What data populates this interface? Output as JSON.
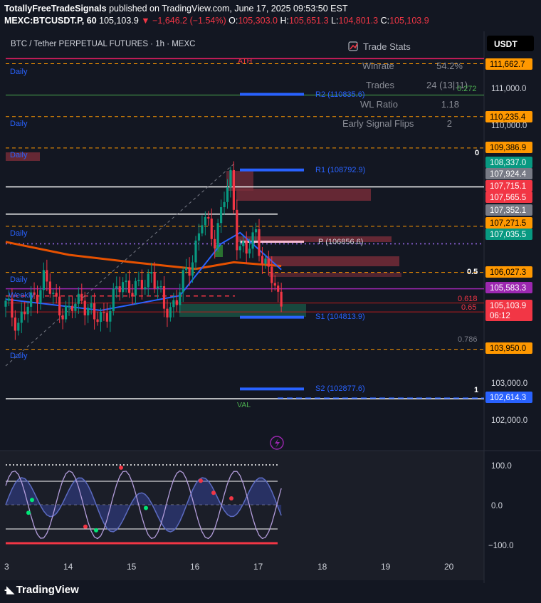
{
  "header": {
    "author": "TotallyFreeTradeSignals",
    "published_text": "published on TradingView.com, June 17, 2025 09:53:50 EST",
    "symbol": "MEXC:BTCUSDT.P, 60",
    "last": "105,103.9",
    "change": "▼ −1,646.2 (−1.54%)",
    "o_label": "O:",
    "o": "105,303.0",
    "h_label": "H:",
    "h": "105,651.3",
    "l_label": "L:",
    "l": "104,801.3",
    "c_label": "C:",
    "c": "105,103.9"
  },
  "legend_title": "BTC / Tether PERPETUAL FUTURES · 1h · MEXC",
  "currency_button": "USDT",
  "trade_stats": {
    "title": "Trade Stats",
    "rows": [
      {
        "label": "Winrate",
        "value": "54.2%"
      },
      {
        "label": "Trades",
        "value": "24 (13|11)"
      },
      {
        "label": "WL Ratio",
        "value": "1.18"
      },
      {
        "label": "Early Signal Flips",
        "value": "2"
      }
    ]
  },
  "level_labels": {
    "ath": "ATH",
    "val": "VAL",
    "r2": "R2 (110835.6)",
    "r1": "R1 (108792.9)",
    "p": "P (106856.6)",
    "s1": "S1 (104813.9)",
    "s2": "S2 (102877.6)",
    "daily": "Daily",
    "weekly": "Weekly",
    "fib_0": "0",
    "fib_05": "0.5",
    "fib_0618": "0.618",
    "fib_065": "0.65",
    "fib_0786": "0.786",
    "fib_1": "1",
    "fib_0272": "0.272"
  },
  "price_axis": {
    "ticks": [
      "111,000.0",
      "110,000.0",
      "103,000.0",
      "102,000.0"
    ],
    "tags": [
      {
        "text": "111,662.7",
        "color": "#ff9800"
      },
      {
        "text": "110,235.4",
        "color": "#ff9800"
      },
      {
        "text": "109,386.9",
        "color": "#ff9800"
      },
      {
        "text": "108,337.0",
        "color": "#089981"
      },
      {
        "text": "107,924.4",
        "color": "#787b86"
      },
      {
        "text": "107,715.1",
        "color": "#f23645"
      },
      {
        "text": "107,565.5",
        "color": "#f23645"
      },
      {
        "text": "107,352.1",
        "color": "#787b86"
      },
      {
        "text": "107,271.5",
        "color": "#ff9800"
      },
      {
        "text": "107,035.5",
        "color": "#089981"
      },
      {
        "text": "106,027.3",
        "color": "#ff9800"
      },
      {
        "text": "105,583.3",
        "color": "#9c27b0"
      },
      {
        "text": "105,103.9",
        "color": "#f23645"
      },
      {
        "text": "06:12",
        "color": "#f23645"
      },
      {
        "text": "103,950.0",
        "color": "#ff9800"
      },
      {
        "text": "102,614.3",
        "color": "#2962ff"
      }
    ]
  },
  "oscillator_axis": {
    "ticks": [
      "100.0",
      "0.0",
      "−100.0"
    ]
  },
  "time_axis": {
    "labels": [
      "3",
      "14",
      "15",
      "16",
      "17",
      "18",
      "19",
      "20"
    ]
  },
  "footer": {
    "brand": "TradingView"
  },
  "colors": {
    "background": "#131722",
    "up": "#089981",
    "down": "#f23645",
    "orange": "#ff9800",
    "blue": "#2962ff",
    "purple": "#9c27b0"
  },
  "chart_data": {
    "type": "candlestick",
    "title": "BTC / Tether PERPETUAL FUTURES · 1h · MEXC",
    "x_labels": [
      "3",
      "14",
      "15",
      "16",
      "17",
      "18",
      "19",
      "20"
    ],
    "ylim": [
      101700,
      112300
    ],
    "close_path": [
      [
        0,
        105100
      ],
      [
        4,
        104700
      ],
      [
        8,
        105200
      ],
      [
        12,
        105900
      ],
      [
        15,
        105300
      ],
      [
        20,
        104900
      ],
      [
        24,
        105400
      ],
      [
        28,
        104700
      ],
      [
        33,
        105100
      ],
      [
        37,
        105800
      ],
      [
        42,
        105500
      ],
      [
        46,
        106100
      ],
      [
        50,
        105000
      ],
      [
        54,
        105300
      ],
      [
        58,
        106200
      ],
      [
        62,
        107400
      ],
      [
        66,
        107000
      ],
      [
        69,
        108000
      ],
      [
        71,
        108500
      ],
      [
        73,
        107000
      ],
      [
        76,
        106500
      ],
      [
        79,
        107100
      ],
      [
        82,
        106200
      ],
      [
        85,
        105600
      ],
      [
        87,
        105104
      ]
    ],
    "moving_averages": [
      {
        "name": "",
        "color": "#e65100",
        "values": [
          [
            0,
            106850
          ],
          [
            20,
            106500
          ],
          [
            40,
            106300
          ],
          [
            60,
            106120
          ],
          [
            72,
            106300
          ],
          [
            87,
            106200
          ]
        ]
      },
      {
        "name": "",
        "color": "#2962ff",
        "values": [
          [
            0,
            105300
          ],
          [
            30,
            105000
          ],
          [
            55,
            105400
          ],
          [
            68,
            106800
          ],
          [
            74,
            107100
          ],
          [
            87,
            106100
          ]
        ]
      }
    ],
    "levels": {
      "ATH": 111800,
      "R2": 110835.6,
      "R1": 108792.9,
      "P": 106856.6,
      "S1": 104813.9,
      "S2": 102877.6,
      "daily": [
        111662.7,
        110235.4,
        109386.9,
        107271.5,
        106027.3,
        103950.0
      ],
      "weekly": 105583.3
    },
    "oscillator": {
      "ylim": [
        -100,
        100
      ],
      "levels": [
        100,
        0,
        -100
      ]
    }
  }
}
